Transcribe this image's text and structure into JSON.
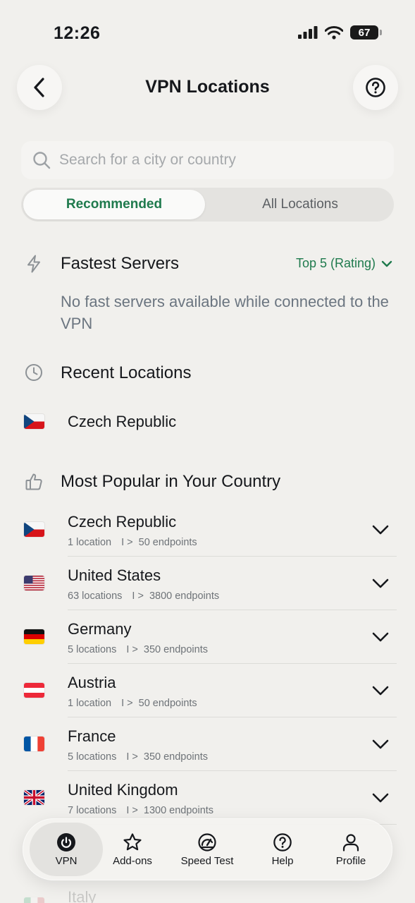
{
  "status_bar": {
    "time": "12:26",
    "battery": "67"
  },
  "header": {
    "title": "VPN Locations"
  },
  "search": {
    "placeholder": "Search for a city or country"
  },
  "segments": {
    "recommended": "Recommended",
    "all": "All Locations",
    "active": "recommended"
  },
  "fastest": {
    "title": "Fastest Servers",
    "rating_label": "Top 5 (Rating)",
    "empty_message": "No fast servers available while connected to the VPN"
  },
  "recent": {
    "title": "Recent Locations",
    "items": [
      {
        "name": "Czech Republic",
        "flag": "cz-flag"
      }
    ]
  },
  "popular": {
    "title": "Most Popular in Your Country",
    "separator": "I >",
    "items": [
      {
        "name": "Czech Republic",
        "locations": "1 location",
        "endpoints": "50 endpoints",
        "flag": "cz-flag"
      },
      {
        "name": "United States",
        "locations": "63 locations",
        "endpoints": "3800 endpoints",
        "flag": "us-flag"
      },
      {
        "name": "Germany",
        "locations": "5 locations",
        "endpoints": "350 endpoints",
        "flag": "de-flag"
      },
      {
        "name": "Austria",
        "locations": "1 location",
        "endpoints": "50 endpoints",
        "flag": "at-flag"
      },
      {
        "name": "France",
        "locations": "5 locations",
        "endpoints": "350 endpoints",
        "flag": "fr-flag"
      },
      {
        "name": "United Kingdom",
        "locations": "7 locations",
        "endpoints": "1300 endpoints",
        "flag": "gb-flag"
      },
      {
        "name": "Italy",
        "flag": "it-flag"
      }
    ]
  },
  "tabbar": {
    "active": "vpn",
    "tabs": [
      {
        "id": "vpn",
        "label": "VPN",
        "icon": "power-icon"
      },
      {
        "id": "addons",
        "label": "Add-ons",
        "icon": "star-icon"
      },
      {
        "id": "speedtest",
        "label": "Speed Test",
        "icon": "speedometer-icon"
      },
      {
        "id": "help",
        "label": "Help",
        "icon": "help-circle-icon"
      },
      {
        "id": "profile",
        "label": "Profile",
        "icon": "person-icon"
      }
    ]
  },
  "colors": {
    "accent": "#1f7a4d",
    "background": "#f1f0ed",
    "muted_text": "#6b7580"
  }
}
